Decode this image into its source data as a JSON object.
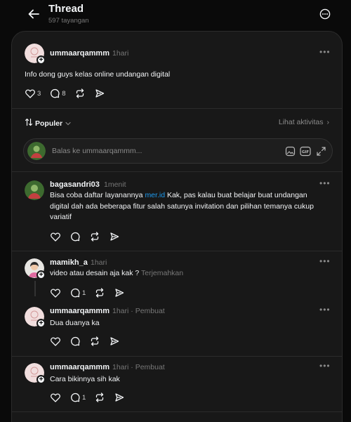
{
  "header": {
    "title": "Thread",
    "views": "597 tayangan"
  },
  "main_post": {
    "username": "ummaarqammm",
    "time": "1hari",
    "text": "Info dong guys kelas online undangan digital",
    "likes": "3",
    "comments": "8"
  },
  "sort": {
    "label": "Populer",
    "activity": "Lihat aktivitas"
  },
  "reply_box": {
    "placeholder": "Balas ke ummaarqammm..."
  },
  "replies": [
    {
      "username": "bagasandri03",
      "time": "1menit",
      "text_before": "Bisa coba daftar layanannya ",
      "link": "mer.id",
      "text_after": " Kak, pas kalau buat belajar buat undangan digital dah ada beberapa fitur salah satunya invitation dan pilihan temanya cukup variatif"
    },
    {
      "username": "mamikh_a",
      "time": "1hari",
      "text": "video atau desain aja kak ?",
      "translate": "Terjemahkan",
      "comments": "1"
    },
    {
      "username": "ummaarqammm",
      "time": "1hari",
      "creator": "· Pembuat",
      "text": "Dua duanya ka"
    },
    {
      "username": "ummaarqammm",
      "time": "1hari",
      "creator": "· Pembuat",
      "text": "Cara bikinnya sih kak",
      "comments": "1"
    }
  ],
  "colors": {
    "background": "#0a0a0a",
    "panel": "#181818",
    "link": "#1d9bf0",
    "muted": "#777777"
  }
}
